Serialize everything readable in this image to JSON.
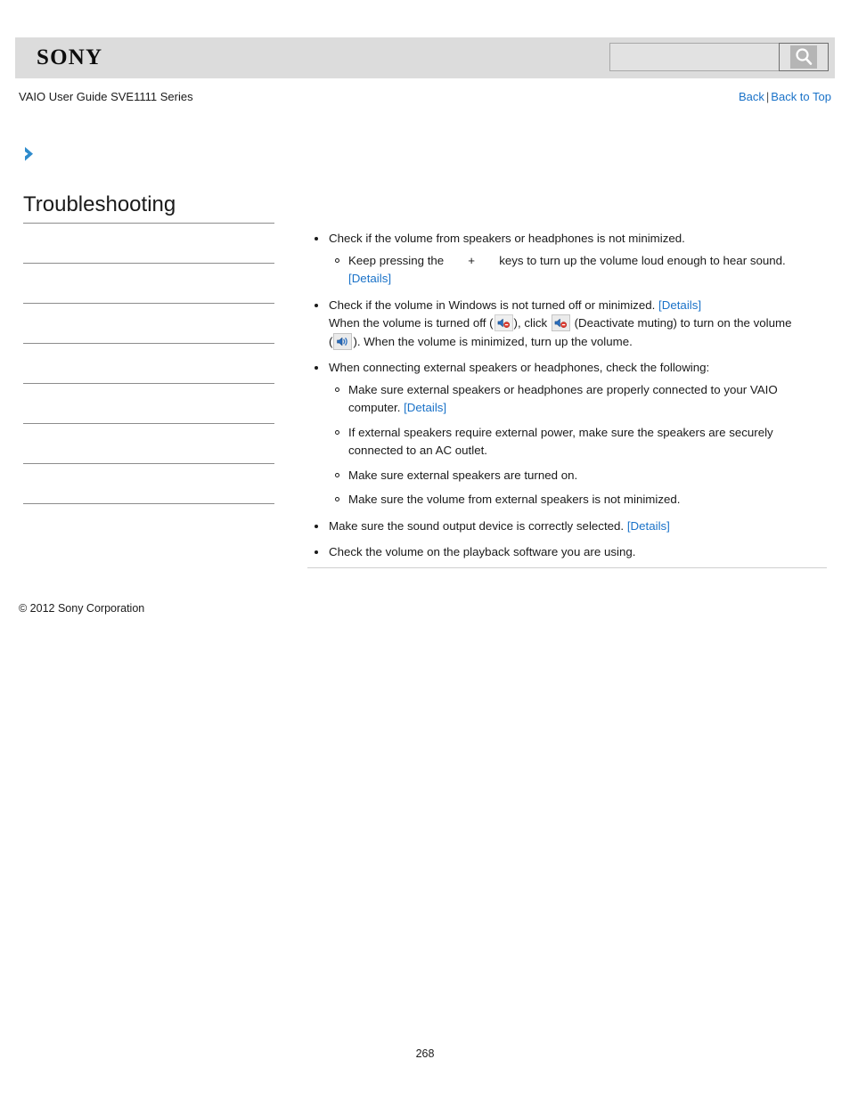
{
  "header": {
    "logo_text": "SONY",
    "search": {
      "value": "",
      "placeholder": "",
      "icon": "search-icon"
    }
  },
  "subheader": {
    "guide_title": "VAIO User Guide SVE1111 Series",
    "back_label": "Back",
    "separator": "|",
    "back_to_top_label": "Back to Top"
  },
  "sidebar": {
    "chevron_icon": "chevron-right-icon",
    "title": "Troubleshooting",
    "items": [
      {
        "label": ""
      },
      {
        "label": ""
      },
      {
        "label": ""
      },
      {
        "label": ""
      },
      {
        "label": ""
      },
      {
        "label": ""
      },
      {
        "label": ""
      }
    ]
  },
  "content": {
    "bullets": [
      {
        "text": "Check if the volume from speakers or headphones is not minimized.",
        "sub": [
          {
            "pre": "Keep pressing the",
            "plus": "+",
            "post": "keys to turn up the volume loud enough to hear sound.",
            "link": "[Details]"
          }
        ]
      },
      {
        "text_a": "Check if the volume in Windows is not turned off or minimized.",
        "link_a": "[Details]",
        "text_b": "When the volume is turned off (",
        "icon_muted_1": "volume-muted-icon",
        "text_c": "), click",
        "icon_muted_2": "volume-muted-icon",
        "text_d": "(Deactivate muting) to turn on the volume",
        "text_e": "(",
        "icon_on": "volume-on-icon",
        "text_f": "). When the volume is minimized, turn up the volume."
      },
      {
        "text": "When connecting external speakers or headphones, check the following:",
        "sub": [
          {
            "text": "Make sure external speakers or headphones are properly connected to your VAIO computer.",
            "link": "[Details]"
          },
          {
            "text": "If external speakers require external power, make sure the speakers are securely connected to an AC outlet."
          },
          {
            "text": "Make sure external speakers are turned on."
          },
          {
            "text": "Make sure the volume from external speakers is not minimized."
          }
        ]
      },
      {
        "text": "Make sure the sound output device is correctly selected.",
        "link": "[Details]"
      },
      {
        "text": "Check the volume on the playback software you are using."
      }
    ]
  },
  "footer": {
    "copyright": "© 2012 Sony Corporation",
    "page_number": "268"
  },
  "colors": {
    "link": "#1a72c8",
    "header_band": "#dcdcdc",
    "rule": "#8c8c8c",
    "chevron": "#2e8bcc"
  }
}
